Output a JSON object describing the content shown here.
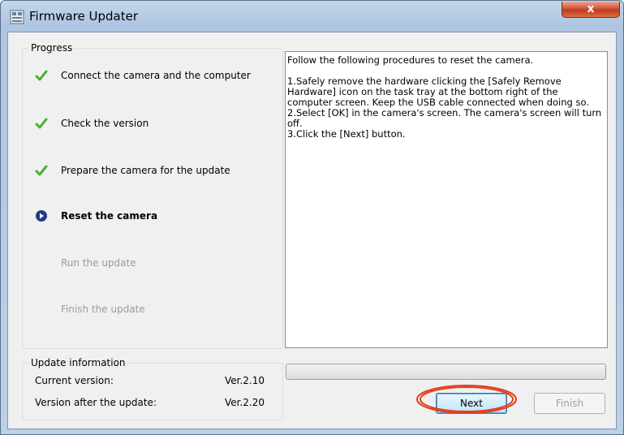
{
  "window": {
    "title": "Firmware Updater",
    "close_label": "x"
  },
  "progress": {
    "heading": "Progress",
    "steps": [
      {
        "label": "Connect the camera and the computer",
        "state": "done"
      },
      {
        "label": "Check the version",
        "state": "done"
      },
      {
        "label": "Prepare the camera for the update",
        "state": "done"
      },
      {
        "label": "Reset the camera",
        "state": "current"
      },
      {
        "label": "Run the update",
        "state": "pending"
      },
      {
        "label": "Finish the update",
        "state": "pending"
      }
    ]
  },
  "instructions": {
    "intro": "Follow the following procedures to reset the camera.",
    "items": [
      "1.Safely remove the hardware clicking the [Safely Remove Hardware] icon on the task tray at the bottom right of the computer screen. Keep the USB cable connected when doing so.",
      "2.Select [OK] in the camera's screen. The camera's screen will turn off.",
      "3.Click the [Next] button."
    ]
  },
  "update_info": {
    "heading": "Update information",
    "current_label": "Current version:",
    "current_value": "Ver.2.10",
    "after_label": "Version after the update:",
    "after_value": "Ver.2.20"
  },
  "progress_bar": {
    "value": 0
  },
  "buttons": {
    "next": "Next",
    "finish": "Finish"
  },
  "colors": {
    "check": "#46b02c",
    "current_step": "#1f3b86",
    "highlight": "#e0401c"
  },
  "icons": {
    "done": "check-mark-icon",
    "current": "arrow-circle-icon",
    "app": "updater-app-icon"
  }
}
